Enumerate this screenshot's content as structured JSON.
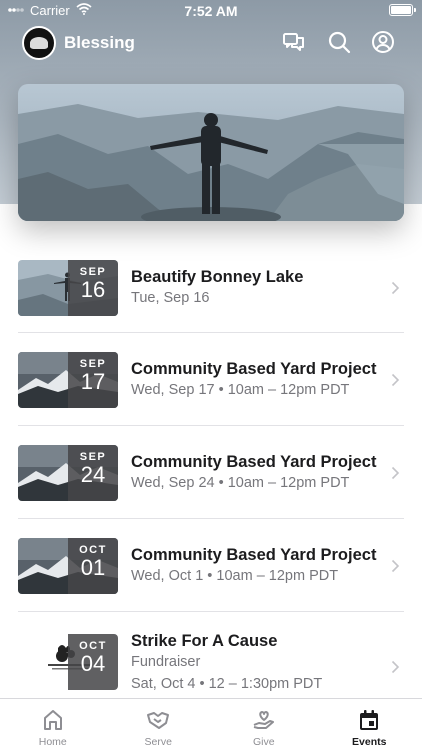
{
  "status_bar": {
    "carrier": "Carrier",
    "time": "7:52 AM"
  },
  "header": {
    "title": "Blessing",
    "logo_icon": "blessing-logo",
    "actions": [
      "chat-icon",
      "search-icon",
      "profile-icon"
    ]
  },
  "hero": {
    "image": "person-on-cliff-photo"
  },
  "events": [
    {
      "month": "SEP",
      "day": "16",
      "title": "Beautify Bonney Lake",
      "subtitle": "Tue, Sep 16",
      "thumb": "cliff"
    },
    {
      "month": "SEP",
      "day": "17",
      "title": "Community Based Yard Project",
      "subtitle": "Wed, Sep 17 • 10am – 12pm PDT",
      "thumb": "mountain"
    },
    {
      "month": "SEP",
      "day": "24",
      "title": "Community Based Yard Project",
      "subtitle": "Wed, Sep 24 • 10am – 12pm PDT",
      "thumb": "mountain"
    },
    {
      "month": "OCT",
      "day": "01",
      "title": "Community Based Yard Project",
      "subtitle": "Wed, Oct 1 • 10am – 12pm PDT",
      "thumb": "mountain"
    },
    {
      "month": "OCT",
      "day": "04",
      "title": "Strike For A Cause",
      "category": "Fundraiser",
      "subtitle": "Sat, Oct 4 • 12 – 1:30pm PDT",
      "thumb": "logo"
    }
  ],
  "tabs": [
    {
      "label": "Home",
      "icon": "home-icon"
    },
    {
      "label": "Serve",
      "icon": "handshake-icon"
    },
    {
      "label": "Give",
      "icon": "heart-hand-icon"
    },
    {
      "label": "Events",
      "icon": "calendar-icon",
      "active": true
    }
  ],
  "colors": {
    "header_band": "#9aa6b1",
    "badge": "#4a4a4c",
    "text": "#1c1c1e",
    "subtext": "#76767b"
  }
}
